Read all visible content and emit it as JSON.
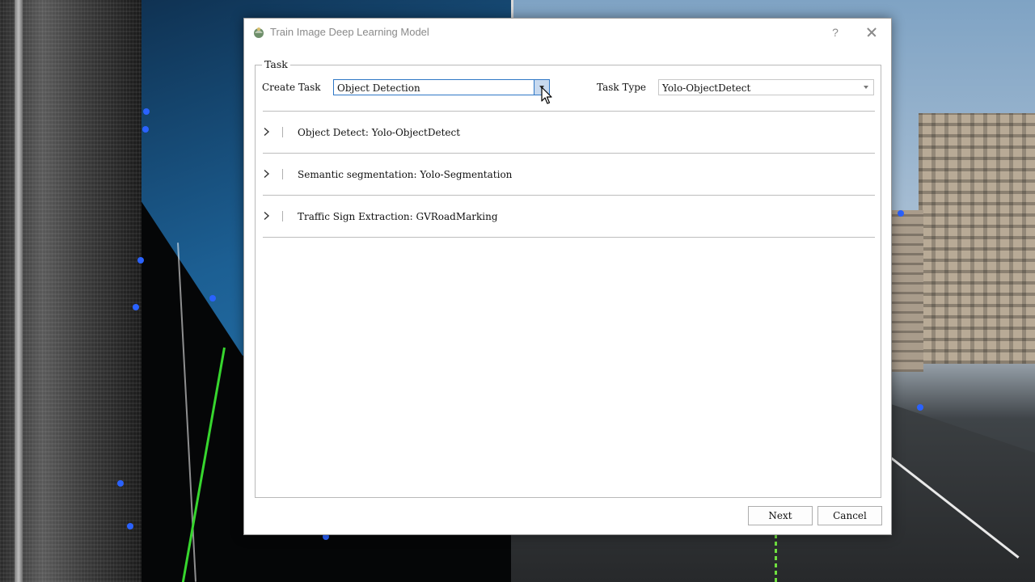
{
  "window": {
    "title": "Train Image Deep Learning Model",
    "help_label": "?"
  },
  "task_group": {
    "legend": "Task",
    "create_task_label": "Create Task",
    "create_task_value": "Object Detection",
    "task_type_label": "Task Type",
    "task_type_value": "Yolo-ObjectDetect"
  },
  "task_list": {
    "items": [
      {
        "label": "Object Detect: Yolo-ObjectDetect",
        "expanded": false
      },
      {
        "label": "Semantic segmentation: Yolo-Segmentation",
        "expanded": false
      },
      {
        "label": "Traffic Sign Extraction: GVRoadMarking",
        "expanded": false
      }
    ]
  },
  "buttons": {
    "next_label": "Next",
    "cancel_label": "Cancel"
  },
  "colors": {
    "accent": "#2f78c6",
    "combo_button_fill": "#c7d9ef",
    "point_marker": "#2a62ff",
    "trajectory": "#37d62e"
  }
}
